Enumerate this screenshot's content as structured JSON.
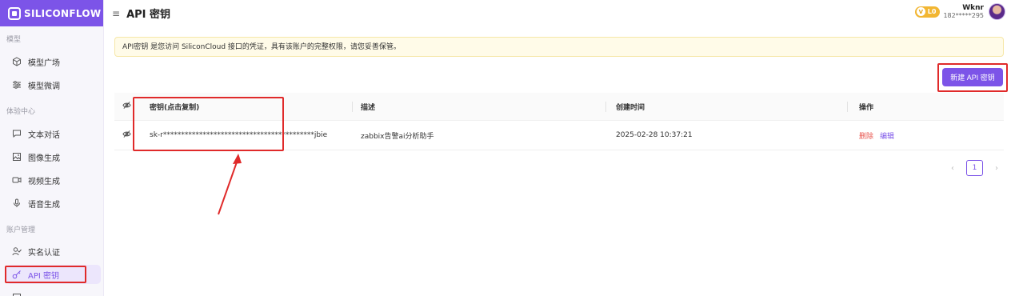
{
  "brand": {
    "name": "SILICONFLOW",
    "bg_color": "#7c54e8"
  },
  "sidebar": {
    "sections": [
      {
        "label": "模型"
      },
      {
        "label": "体验中心"
      },
      {
        "label": "账户管理"
      }
    ],
    "items": [
      {
        "label": "模型广场",
        "icon": "cube-icon"
      },
      {
        "label": "模型微调",
        "icon": "sliders-icon"
      },
      {
        "label": "文本对话",
        "icon": "chat-icon"
      },
      {
        "label": "图像生成",
        "icon": "image-icon"
      },
      {
        "label": "视频生成",
        "icon": "video-icon"
      },
      {
        "label": "语音生成",
        "icon": "microphone-icon"
      },
      {
        "label": "实名认证",
        "icon": "user-check-icon"
      },
      {
        "label": "API 密钥",
        "icon": "key-icon",
        "active": true
      }
    ]
  },
  "header": {
    "title": "API 密钥",
    "menu_icon": "≡"
  },
  "user": {
    "level": "L0",
    "name": "Wknr",
    "phone": "182*****295"
  },
  "notice": {
    "text": "API密钥 是您访问 SiliconCloud 接口的凭证，具有该账户的完整权限，请您妥善保管。"
  },
  "actions": {
    "new_key_label": "新建 API 密钥"
  },
  "table": {
    "columns": {
      "key": "密钥(点击复制)",
      "desc": "描述",
      "created": "创建时间",
      "ops": "操作"
    },
    "rows": [
      {
        "key": "sk-r******************************************jbie",
        "desc": "zabbix告警ai分析助手",
        "created": "2025-02-28 10:37:21",
        "delete_label": "删除",
        "edit_label": "编辑"
      }
    ]
  },
  "pagination": {
    "current": "1",
    "prev": "‹",
    "next": "›"
  },
  "colors": {
    "accent": "#7c54e8",
    "danger": "#e8554e",
    "annotation": "#e02a2a"
  }
}
